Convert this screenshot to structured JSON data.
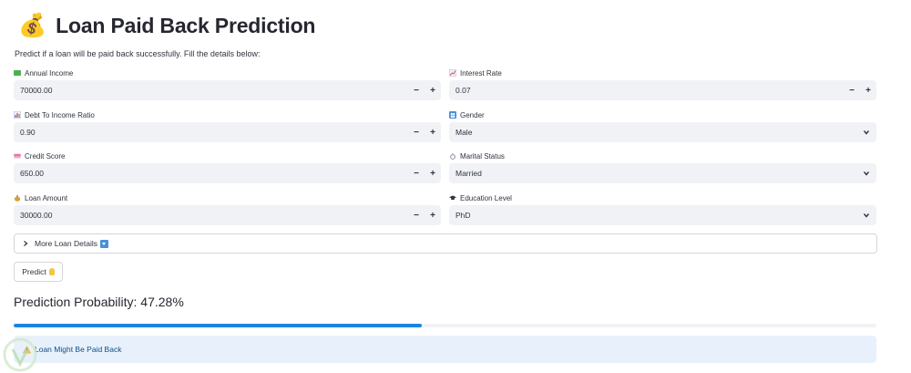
{
  "header": {
    "title": "Loan Paid Back Prediction",
    "title_emoji": "💰"
  },
  "subtitle": "Predict if a loan will be paid back successfully. Fill the details below:",
  "fields": {
    "annual_income": {
      "label": "Annual Income",
      "value": "70000.00",
      "icon": "money-icon"
    },
    "interest_rate": {
      "label": "Interest Rate",
      "value": "0.07",
      "icon": "chart-up-icon"
    },
    "debt_to_income": {
      "label": "Debt To Income Ratio",
      "value": "0.90",
      "icon": "bar-chart-icon"
    },
    "gender": {
      "label": "Gender",
      "value": "Male",
      "icon": "people-icon"
    },
    "credit_score": {
      "label": "Credit Score",
      "value": "650.00",
      "icon": "credit-card-icon"
    },
    "marital_status": {
      "label": "Marital Status",
      "value": "Married",
      "icon": "ring-icon"
    },
    "loan_amount": {
      "label": "Loan Amount",
      "value": "30000.00",
      "icon": "money-bag-icon"
    },
    "education_level": {
      "label": "Education Level",
      "value": "PhD",
      "icon": "graduation-cap-icon"
    }
  },
  "stepper": {
    "minus": "−",
    "plus": "+"
  },
  "expander": {
    "label": "More Loan Details"
  },
  "predict_button": {
    "label": "Predict"
  },
  "result": {
    "probability_text": "Prediction Probability: 47.28%",
    "probability": 0.4728,
    "message": "Loan Might Be Paid Back"
  },
  "colors": {
    "accent": "#1c83e1",
    "input_bg": "#f0f2f6",
    "alert_bg": "#e8f1fb",
    "alert_text": "#0c4f8c"
  }
}
